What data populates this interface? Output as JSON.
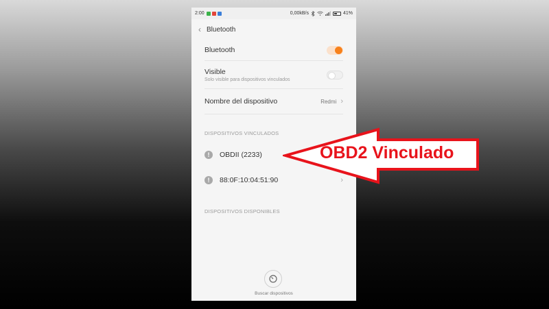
{
  "status_bar": {
    "time": "2:00",
    "app_icons": [
      {
        "name": "green-app-icon",
        "color": "#3bb24a"
      },
      {
        "name": "red-app-icon",
        "color": "#e2463a"
      },
      {
        "name": "blue-app-icon",
        "color": "#3b7fd9"
      }
    ],
    "speed": "0,00kB/s",
    "battery": "41%"
  },
  "header": {
    "title": "Bluetooth"
  },
  "settings": {
    "bluetooth_label": "Bluetooth",
    "bluetooth_on": true,
    "visible_label": "Visible",
    "visible_sub": "Solo visible para dispositivos vinculados",
    "visible_on": false,
    "device_name_label": "Nombre del dispositivo",
    "device_name_value": "Redmi"
  },
  "paired": {
    "section_title": "DISPOSITIVOS VINCULADOS",
    "devices": [
      {
        "name": "OBDII (2233)"
      },
      {
        "name": "88:0F:10:04:51:90"
      }
    ]
  },
  "available": {
    "section_title": "DISPOSITIVOS DISPONIBLES"
  },
  "scan": {
    "label": "Buscar dispositivos"
  },
  "annotation": {
    "text": "OBD2 Vinculado",
    "color": "#e8131b"
  },
  "colors": {
    "accent": "#f7811c"
  }
}
